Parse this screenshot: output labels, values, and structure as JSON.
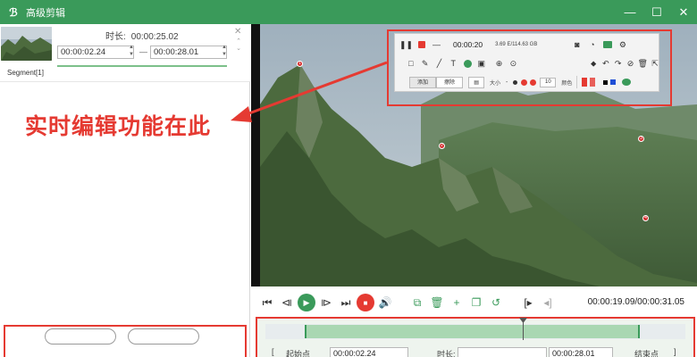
{
  "window": {
    "title": "高级剪辑",
    "logo": "ℬ",
    "controls": {
      "minimize": "—",
      "maximize": "☐",
      "close": "✕"
    }
  },
  "segment": {
    "duration_label": "时长:",
    "duration_value": "00:00:25.02",
    "start_time": "00:00:02.24",
    "end_time": "00:00:28.01",
    "separator": "—",
    "label": "Segment[1]"
  },
  "annotation": {
    "text": "实时编辑功能在此"
  },
  "toolbar": {
    "time": "00:00:20",
    "size": "3.69 E/114.63 GB",
    "tab_1": "添加",
    "tab_2": "擦除",
    "size_label": "大小",
    "size_value": "10",
    "opacity_label": "颜色",
    "color_red": "#e53a32",
    "color_black": "#000000",
    "color_blue": "#1f4fd6"
  },
  "video": {
    "markers": [
      "1",
      "2",
      "3",
      "4"
    ]
  },
  "player": {
    "time_readout": "00:00:19.09/00:00:31.05"
  },
  "timeline": {
    "start_label": "起始点",
    "start_time": "00:00:02.24",
    "duration_label": "时长:",
    "end_time": "00:00:28.01",
    "end_label": "结束点"
  },
  "colors": {
    "brand": "#3a9a5a",
    "accent_red": "#e53a32"
  }
}
